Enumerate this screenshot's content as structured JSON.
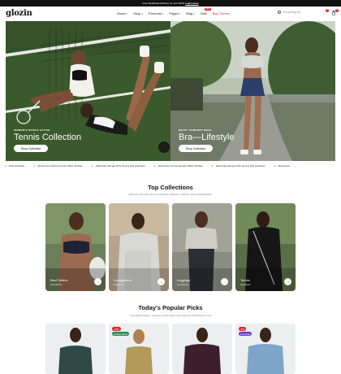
{
  "topbar": {
    "promo_text": "Free Worldwide Delivery for over $150.",
    "promo_link": "Learn more"
  },
  "header": {
    "logo": "glozin",
    "nav": [
      {
        "label": "Home",
        "chevron": true,
        "red": false
      },
      {
        "label": "Shop",
        "chevron": true,
        "red": false
      },
      {
        "label": "Products",
        "chevron": true,
        "red": false
      },
      {
        "label": "Pages",
        "chevron": true,
        "red": false
      },
      {
        "label": "Blog",
        "chevron": true,
        "red": false
      },
      {
        "label": "Sale",
        "chevron": false,
        "red": false,
        "badge": "HOT"
      },
      {
        "label": "Buy Theme!",
        "chevron": false,
        "red": true
      }
    ],
    "search_placeholder": "I'm looking for...",
    "wishlist_count": "0",
    "cart_count": "0"
  },
  "heroes": [
    {
      "tag": "WOMEN'S BASICS ACTIVE",
      "title": "Tennis Collection",
      "button": "Shop Collection"
    },
    {
      "tag": "ENJOY COMFORT BRAS",
      "title": "Bra—Lifestyle",
      "button": "Shop Collection"
    }
  ],
  "ticker": [
    "First purchase",
    "Street-free returns process within 30 days",
    "Subscribe and get 10% off your first purchase",
    "Street-free returns product within 30 days",
    "Subscribe and get 10% off your first purchase",
    "Street-free"
  ],
  "top_collections": {
    "title": "Top Collections",
    "subtitle": "Express your style with our standout collection—fashion meets sophistication",
    "items": [
      {
        "name": "Best Sellers",
        "count": "15 products"
      },
      {
        "name": "Loungewear",
        "count": "8 products"
      },
      {
        "name": "Leggings",
        "count": "12 products"
      },
      {
        "name": "Tennis",
        "count": "9 products"
      }
    ]
  },
  "popular": {
    "title": "Today's Popular Picks",
    "subtitle": "Unmatched design—superior performance and customer satisfaction in one",
    "products": [
      {
        "badges": []
      },
      {
        "badges": [
          {
            "text": "-33%",
            "color": "#e4252d"
          },
          {
            "text": "Limited Stock",
            "color": "#2e8b57"
          }
        ]
      },
      {
        "badges": []
      },
      {
        "badges": [
          {
            "text": "-5%",
            "color": "#e4252d"
          },
          {
            "text": "Pre-Order",
            "color": "#6b3fd0"
          }
        ]
      }
    ]
  },
  "colors": {
    "accent": "#e4252d",
    "topbar": "#111111",
    "court_green": "#3e5a2e"
  }
}
